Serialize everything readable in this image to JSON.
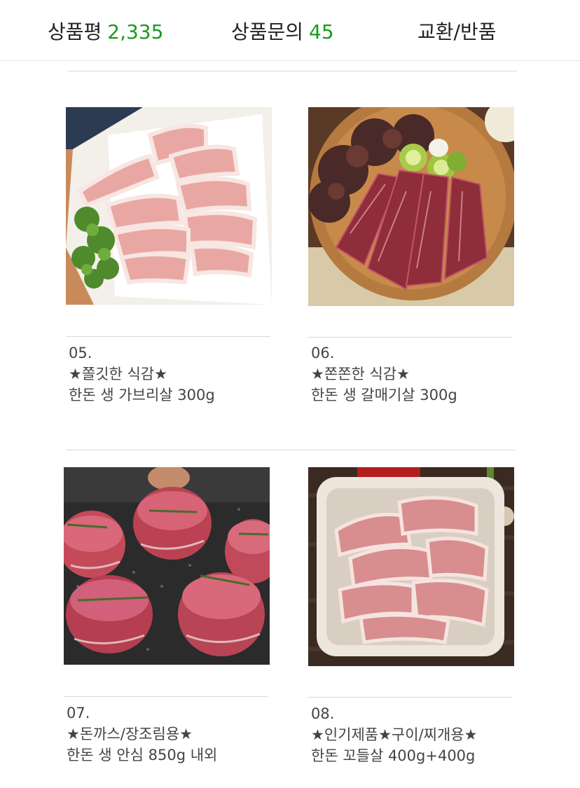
{
  "tabs": {
    "reviews": {
      "label": "상품평",
      "count": "2,335"
    },
    "qna": {
      "label": "상품문의",
      "count": "45"
    },
    "return": {
      "label": "교환/반품"
    }
  },
  "accent_color": "#1a9b1a",
  "products": [
    {
      "number": "05.",
      "tagline": "★쫄깃한 식감★",
      "name": "한돈 생 가브리살 300g",
      "image": "sliced pork on white plate with herbs"
    },
    {
      "number": "06.",
      "tagline": "★쫀쫀한 식감★",
      "name": "한돈 생 갈매기살 300g",
      "image": "pork skirt on wooden board with lettuce"
    },
    {
      "number": "07.",
      "tagline": "★돈까스/장조림용★",
      "name": "한돈 생 안심 850g 내외",
      "image": "pork tenderloin medallions with rosemary"
    },
    {
      "number": "08.",
      "tagline": "★인기제품★구이/찌개용★",
      "name": "한돈 꼬들살 400g+400g",
      "image": "pork slices in white square tray"
    }
  ]
}
